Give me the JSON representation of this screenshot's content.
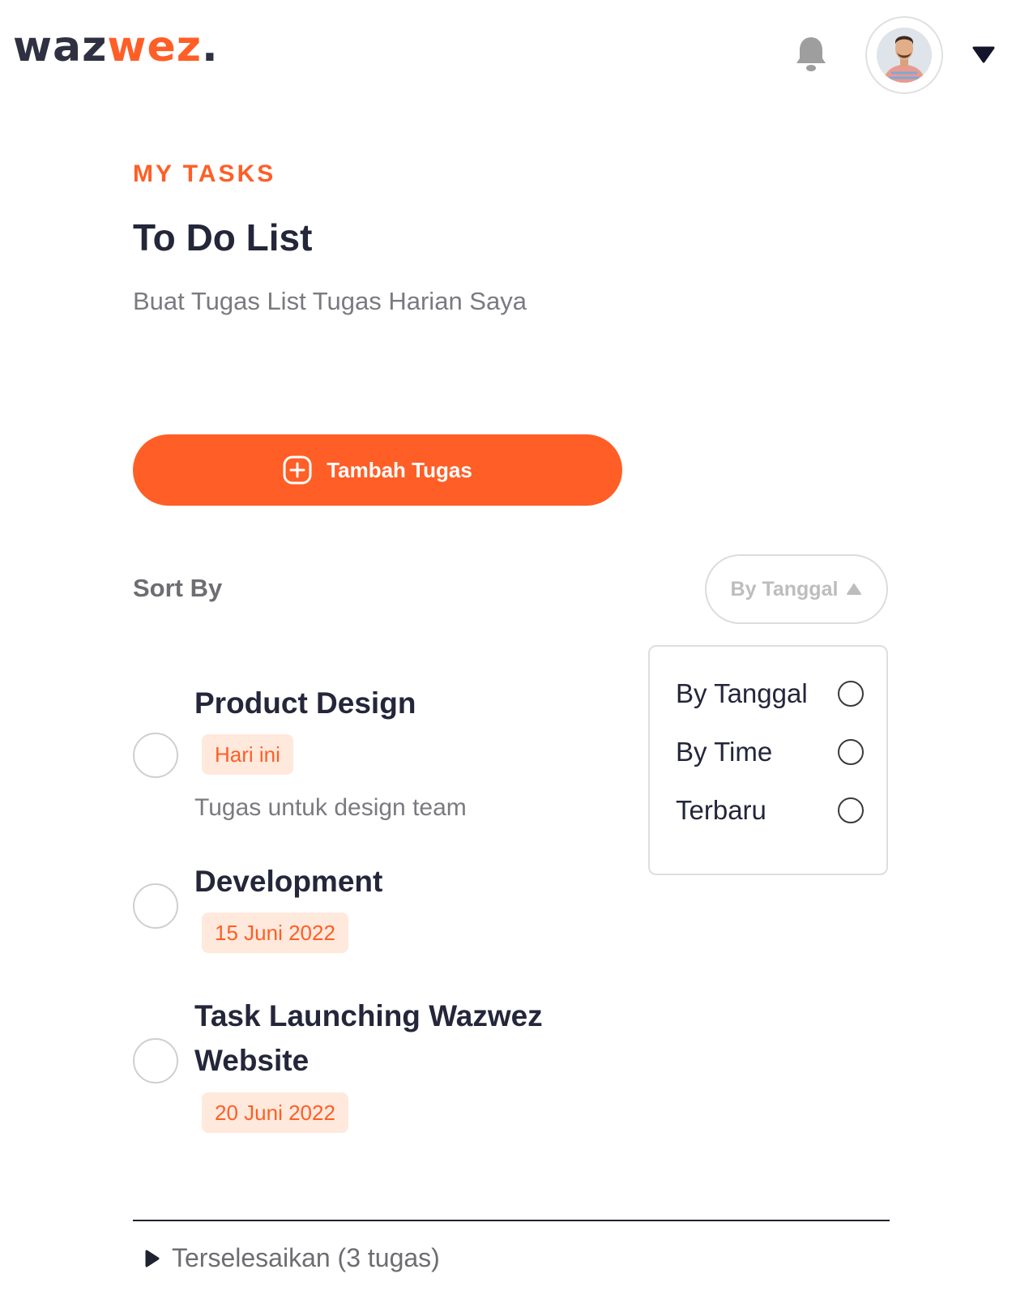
{
  "header": {
    "logo_part1": "waz",
    "logo_part2": "wez",
    "logo_part3": ".",
    "bell_icon": "bell-icon",
    "avatar_icon": "user-avatar",
    "menu_icon": "caret-down-icon"
  },
  "page": {
    "eyebrow": "MY TASKS",
    "title": "To Do List",
    "subtitle": "Buat Tugas List Tugas Harian Saya"
  },
  "add_button": {
    "label": "Tambah Tugas",
    "icon": "plus-circle-icon"
  },
  "sort": {
    "label": "Sort By",
    "button_label": "By Tanggal",
    "options": [
      {
        "label": "By Tanggal",
        "selected": false
      },
      {
        "label": "By Time",
        "selected": false
      },
      {
        "label": "Terbaru",
        "selected": false
      }
    ]
  },
  "tasks": [
    {
      "title": "Product Design",
      "tag": "Hari ini",
      "description": "Tugas untuk design team"
    },
    {
      "title": "Development",
      "tag": "15 Juni 2022"
    },
    {
      "title": "Task Launching Wazwez Website",
      "tag": "20 Juni 2022"
    }
  ],
  "completed": {
    "label": "Terselesaikan (3 tugas)"
  },
  "colors": {
    "accent": "#ff5e26",
    "tag_bg": "#ffe9dc",
    "text_dark": "#24263a",
    "text_muted": "#7a7a80"
  }
}
